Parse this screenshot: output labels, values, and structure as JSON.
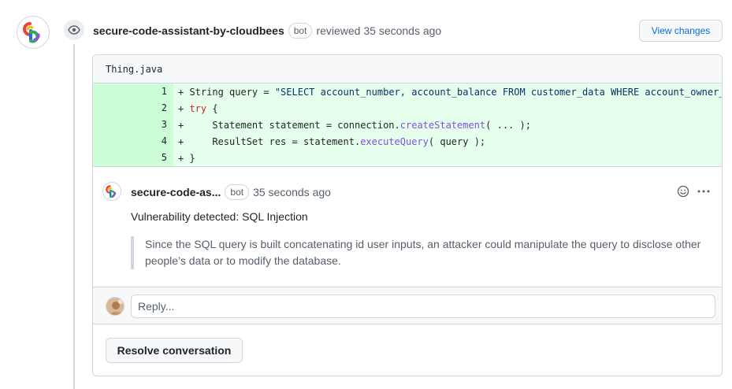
{
  "review": {
    "author": "secure-code-assistant-by-cloudbees",
    "bot_label": "bot",
    "action_text": "reviewed 35 seconds ago",
    "view_changes_label": "View changes"
  },
  "file": {
    "name": "Thing.java",
    "lines": [
      {
        "num": "1",
        "parts": [
          {
            "t": "+ String query = ",
            "c": ""
          },
          {
            "t": "\"SELECT account_number, account_balance FROM customer_data WHERE account_owner_id = \" + id;",
            "c": "str"
          }
        ]
      },
      {
        "num": "2",
        "parts": [
          {
            "t": "+ ",
            "c": ""
          },
          {
            "t": "try",
            "c": "kw"
          },
          {
            "t": " {",
            "c": ""
          }
        ]
      },
      {
        "num": "3",
        "parts": [
          {
            "t": "+     Statement statement = connection.",
            "c": ""
          },
          {
            "t": "createStatement",
            "c": "fn"
          },
          {
            "t": "( ... );",
            "c": ""
          }
        ]
      },
      {
        "num": "4",
        "parts": [
          {
            "t": "+     ResultSet res = statement.",
            "c": ""
          },
          {
            "t": "executeQuery",
            "c": "fn"
          },
          {
            "t": "( query );",
            "c": ""
          }
        ]
      },
      {
        "num": "5",
        "parts": [
          {
            "t": "+ }",
            "c": ""
          }
        ]
      }
    ]
  },
  "comment": {
    "author": "secure-code-as...",
    "bot_label": "bot",
    "time": "35 seconds ago",
    "title": "Vulnerability detected: SQL Injection",
    "quote": "Since the SQL query is built concatenating id user inputs, an attacker could manipulate the query to disclose other people’s data or to modify the database."
  },
  "reply": {
    "placeholder": "Reply..."
  },
  "resolve_label": "Resolve conversation",
  "icons": {
    "review_badge": "eye-icon",
    "reaction": "smiley-icon",
    "menu": "kebab-horizontal-icon"
  },
  "colors": {
    "link": "#0969da",
    "diff_added_bg": "#e6ffec",
    "diff_added_num_bg": "#ccffd8",
    "keyword": "#cf222e",
    "function": "#8250df",
    "muted": "#57606a"
  }
}
